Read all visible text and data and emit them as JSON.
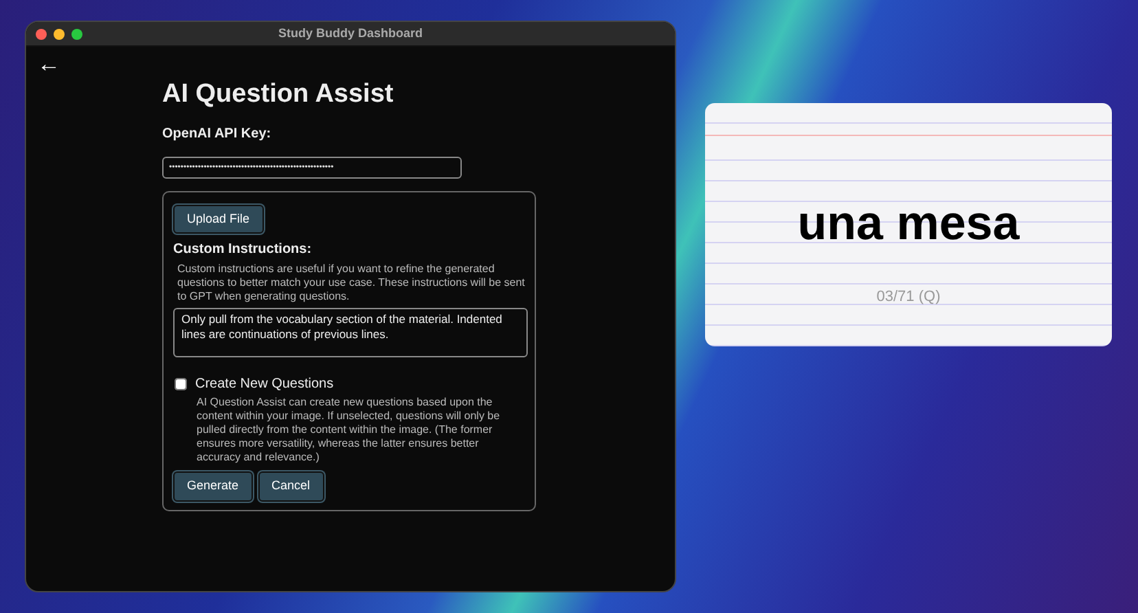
{
  "window": {
    "title": "Study Buddy Dashboard",
    "back": "←"
  },
  "form": {
    "heading": "AI Question Assist",
    "api_key_label": "OpenAI API Key:",
    "api_key_value": "•••••••••••••••••••••••••••••••••••••••••••••••••••••••••",
    "upload_button": "Upload File",
    "instructions_label": "Custom Instructions:",
    "instructions_help": "Custom instructions are useful if you want to refine the generated questions to better match your use case. These instructions will be sent to GPT when generating questions.",
    "instructions_value": "Only pull from the vocabulary section of the material. Indented lines are continuations of previous lines.",
    "create_new": {
      "label": "Create New Questions",
      "checked": false,
      "help": "AI Question Assist can create new questions based upon the content within your image. If unselected, questions will only be pulled directly from the content within the image. (The former ensures more versatility, whereas the latter ensures better accuracy and relevance.)"
    },
    "buttons": [
      "Generate",
      "Cancel"
    ]
  },
  "flashcard": {
    "term": "una mesa",
    "counter": "03/71 (Q)"
  }
}
